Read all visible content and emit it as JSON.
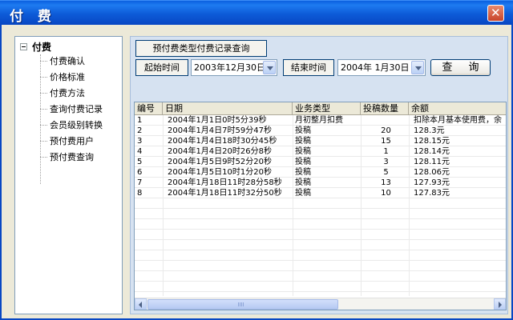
{
  "window": {
    "title": "付 费",
    "close_glyph": "✕"
  },
  "tree": {
    "root_label": "付费",
    "items": [
      {
        "label": "付费确认"
      },
      {
        "label": "价格标准"
      },
      {
        "label": "付费方法"
      },
      {
        "label": "查询付费记录"
      },
      {
        "label": "会员级别转换"
      },
      {
        "label": "预付费用户"
      },
      {
        "label": "预付费查询"
      }
    ]
  },
  "query": {
    "title_button": "预付费类型付费记录查询",
    "start_label": "起始时间",
    "start_value": "2003年12月30日",
    "end_label": "结束时间",
    "end_value": "2004年  1月30日",
    "search_button": "查 询"
  },
  "table": {
    "columns": [
      "编号",
      "日期",
      "业务类型",
      "投稿数量",
      "余额"
    ],
    "rows": [
      [
        "1",
        "2004年1月1日0时5分39秒",
        "月初整月扣费",
        "",
        "扣除本月基本使用费，余"
      ],
      [
        "2",
        "2004年1月4日7时59分47秒",
        "投稿",
        "20",
        "128.3元"
      ],
      [
        "3",
        "2004年1月4日18时30分45秒",
        "投稿",
        "15",
        "128.15元"
      ],
      [
        "4",
        "2004年1月4日20时26分8秒",
        "投稿",
        "1",
        "128.14元"
      ],
      [
        "5",
        "2004年1月5日9时52分20秒",
        "投稿",
        "3",
        "128.11元"
      ],
      [
        "6",
        "2004年1月5日10时1分20秒",
        "投稿",
        "5",
        "128.06元"
      ],
      [
        "7",
        "2004年1月18日11时28分58秒",
        "投稿",
        "13",
        "127.93元"
      ],
      [
        "8",
        "2004年1月18日11时32分50秒",
        "投稿",
        "10",
        "127.83元"
      ]
    ]
  },
  "colors": {
    "titlebar": "#0A5FE0",
    "panel": "#D6E2F1",
    "window": "#ECE9D8"
  }
}
